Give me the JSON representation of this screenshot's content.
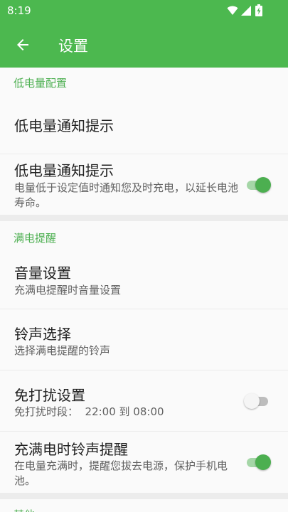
{
  "status_bar": {
    "time": "8:19",
    "icons": [
      "wifi-icon",
      "cellular-signal-icon",
      "battery-charging-icon"
    ]
  },
  "app_bar": {
    "back_icon": "arrow-back-icon",
    "title": "设置"
  },
  "sections": {
    "low_battery": {
      "header": "低电量配置",
      "notify_item": {
        "title": "低电量通知提示"
      },
      "notify_toggle": {
        "title": "低电量通知提示",
        "subtitle": "电量低于设定值时通知您及时充电，以延长电池寿命。",
        "on": true
      }
    },
    "full_charge": {
      "header": "满电提醒",
      "volume": {
        "title": "音量设置",
        "subtitle": "充满电提醒时音量设置"
      },
      "ringtone": {
        "title": "铃声选择",
        "subtitle": "选择满电提醒的铃声"
      },
      "dnd": {
        "title": "免打扰设置",
        "subtitle": "免打扰时段：  22:00 到 08:00",
        "on": false
      },
      "full_ring": {
        "title": "充满电时铃声提醒",
        "subtitle": "在电量充满时，提醒您拔去电源，保护手机电池。",
        "on": true
      }
    },
    "other": {
      "header": "其他"
    }
  },
  "colors": {
    "primary": "#4cb84f",
    "accent": "#4caf50",
    "background": "#fafafa"
  }
}
